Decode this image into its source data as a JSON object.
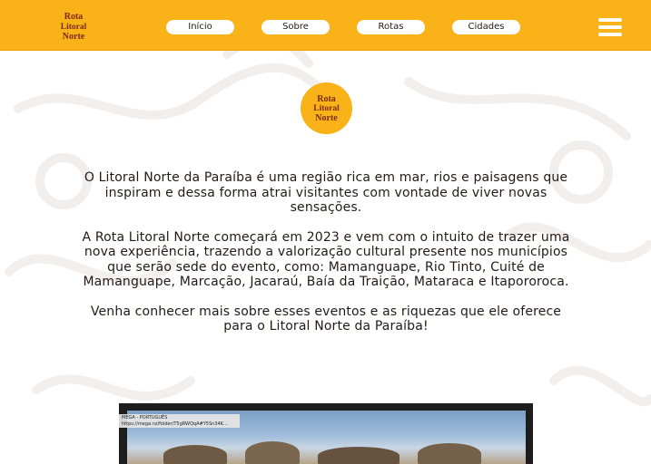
{
  "colors": {
    "accent": "#f9b218",
    "text": "#231a16",
    "logo_ink": "#7a2a10"
  },
  "logo": {
    "line1": "Rota",
    "line2": "Litoral",
    "line3": "Norte"
  },
  "nav": {
    "items": [
      {
        "label": "Início"
      },
      {
        "label": "Sobre"
      },
      {
        "label": "Rotas"
      },
      {
        "label": "Cidades"
      }
    ],
    "menu_icon": "hamburger-menu-icon"
  },
  "intro": {
    "paragraphs": [
      "O Litoral Norte da Paraíba é uma região rica em mar, rios e paisagens que inspiram e dessa forma atrai visitantes com vontade de viver novas sensações.",
      "A Rota Litoral Norte começará em 2023 e vem com o intuito de trazer uma nova experiência, trazendo a valorização cultural presente nos municípios que serão sede do evento, como: Mamanguape, Rio Tinto, Cuité de Mamanguape, Marcação, Jacaraú, Baía da Traição, Mataraca e Itapororoca.",
      "Venha conhecer mais sobre esses eventos e as riquezas que ele oferece para o Litoral Norte da Paraíba!"
    ]
  },
  "video": {
    "overlay_title": "MEGA - PORTUGUÊS",
    "overlay_url": "https://mega.nz/folder/T5gRWQqA#Y5Sn34K..."
  }
}
